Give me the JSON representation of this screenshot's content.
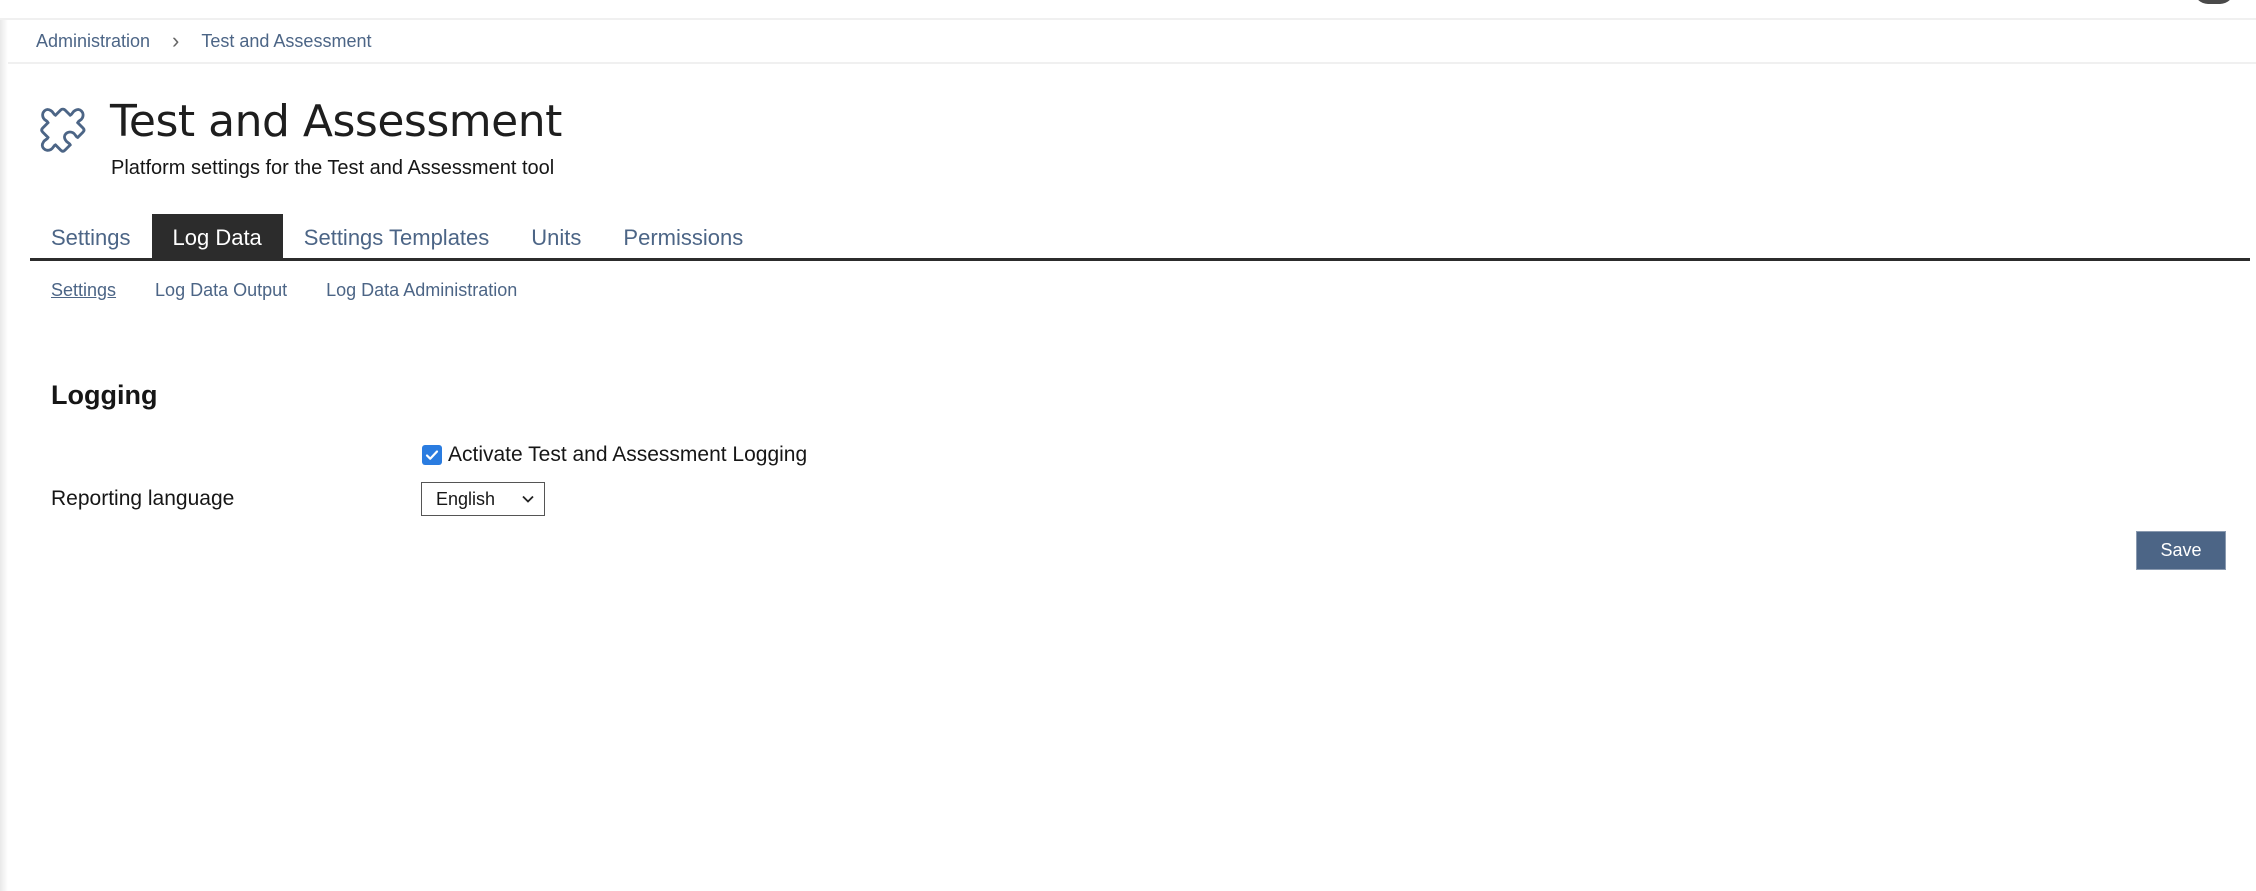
{
  "breadcrumb": {
    "items": [
      "Administration",
      "Test and Assessment"
    ],
    "separator": ">"
  },
  "header": {
    "icon": "puzzle-piece-icon",
    "title": "Test and Assessment",
    "subtitle": "Platform settings for the Test and Assessment tool"
  },
  "tabs": [
    {
      "label": "Settings",
      "active": false
    },
    {
      "label": "Log Data",
      "active": true
    },
    {
      "label": "Settings Templates",
      "active": false
    },
    {
      "label": "Units",
      "active": false
    },
    {
      "label": "Permissions",
      "active": false
    }
  ],
  "subtabs": [
    {
      "label": "Settings",
      "active": true
    },
    {
      "label": "Log Data Output",
      "active": false
    },
    {
      "label": "Log Data Administration",
      "active": false
    }
  ],
  "form": {
    "section_title": "Logging",
    "activate_logging": {
      "label": "Activate Test and Assessment Logging",
      "checked": true
    },
    "reporting_language": {
      "label": "Reporting language",
      "value": "English"
    },
    "save_label": "Save"
  },
  "colors": {
    "link": "#4c6586",
    "active_tab_bg": "#2c2c2c",
    "checkbox": "#2a7ce0",
    "primary_button": "#4c6586"
  }
}
